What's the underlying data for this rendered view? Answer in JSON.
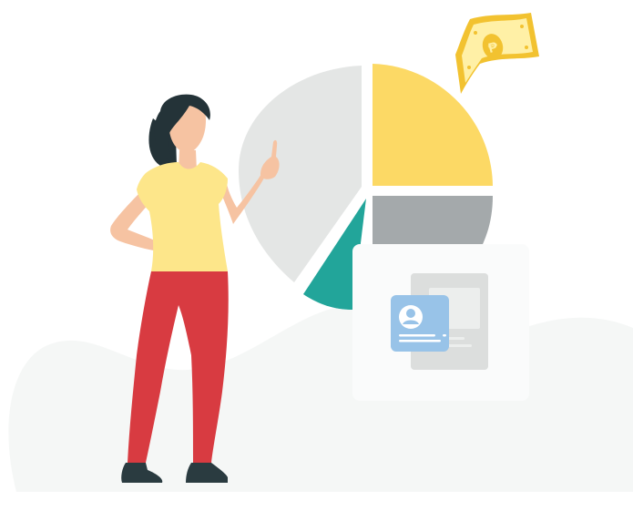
{
  "illustration": {
    "colors": {
      "background": "#ffffff",
      "backdrop": "#f5f7f6",
      "pie_gray": "#e4e6e5",
      "pie_yellow": "#fcd965",
      "pie_slate": "#a4a9ab",
      "pie_teal": "#22a59a",
      "card": "#fafbfb",
      "doc": "#dcdedd",
      "profile_card": "#98c3e8",
      "banknote": "#fff0a6",
      "banknote_edge": "#f2c230",
      "shirt": "#fde68a",
      "pants": "#d83b41",
      "skin": "#f6c3a2",
      "hair": "#243338",
      "shoes": "#2a3b40"
    },
    "icons": {
      "banknote": "peso-banknote-icon",
      "profile": "user-avatar-icon"
    }
  }
}
